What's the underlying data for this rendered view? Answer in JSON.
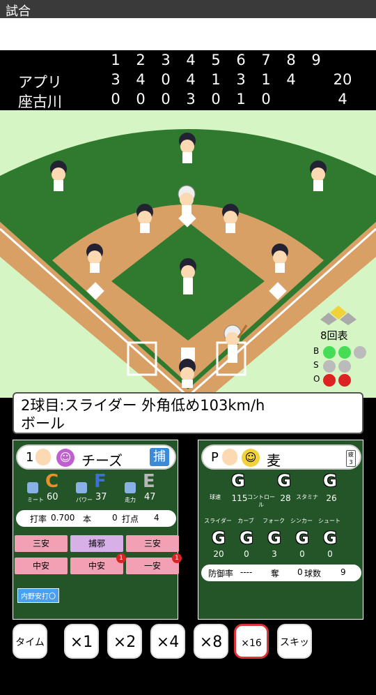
{
  "window_title": "試合",
  "scoreboard": {
    "innings": [
      "1",
      "2",
      "3",
      "4",
      "5",
      "6",
      "7",
      "8",
      "9"
    ],
    "teams": [
      {
        "name": "アプリ",
        "scores": [
          "3",
          "4",
          "0",
          "4",
          "1",
          "3",
          "1",
          "4",
          ""
        ],
        "total": "20"
      },
      {
        "name": "座古川",
        "scores": [
          "0",
          "0",
          "0",
          "3",
          "0",
          "1",
          "0",
          "",
          ""
        ],
        "total": "4"
      }
    ]
  },
  "inning_label": "8回表",
  "count": {
    "b_label": "B",
    "s_label": "S",
    "o_label": "O",
    "balls": 2,
    "strikes": 0,
    "outs": 2,
    "ball_color": "#44dd55",
    "strike_color": "#f2d23a",
    "out_color": "#dd2222",
    "off_color": "#bbbbbb"
  },
  "play": {
    "line1": "2球目:スライダー 外角低め103km/h",
    "line2": "ボール"
  },
  "batter": {
    "order": "1",
    "name": "チーズ",
    "position": "捕",
    "stats": [
      {
        "label": "ミート",
        "grade": "C",
        "value": "60",
        "color": "#e8902a"
      },
      {
        "label": "パワー",
        "grade": "F",
        "value": "37",
        "color": "#3f70d8"
      },
      {
        "label": "走力",
        "grade": "E",
        "value": "47",
        "color": "#b8b8b8"
      }
    ],
    "avg_label": "打率",
    "avg": "0.700",
    "hr_label": "本",
    "hr": "0",
    "rbi_label": "打点",
    "rbi": "4",
    "history": [
      {
        "text": "三安",
        "color": "#f4a0b4",
        "badge": ""
      },
      {
        "text": "捕邪",
        "color": "#d8b0e8",
        "badge": ""
      },
      {
        "text": "三安",
        "color": "#f4a0b4",
        "badge": ""
      },
      {
        "text": "中安",
        "color": "#f4a0b4",
        "badge": ""
      },
      {
        "text": "中安",
        "color": "#f4a0b4",
        "badge": "1"
      },
      {
        "text": "一安",
        "color": "#f4a0b4",
        "badge": "1"
      }
    ],
    "skill": "内野安打〇"
  },
  "pitcher": {
    "position": "P",
    "name": "麦",
    "tag": "疲3",
    "stats": [
      {
        "label": "球速",
        "grade": "G",
        "value": "115"
      },
      {
        "label": "コントロール",
        "grade": "G",
        "value": "28"
      },
      {
        "label": "スタミナ",
        "grade": "G",
        "value": "26"
      }
    ],
    "pitches": [
      {
        "label": "スライダー",
        "grade": "G",
        "value": "20"
      },
      {
        "label": "カーブ",
        "grade": "G",
        "value": "0"
      },
      {
        "label": "フォーク",
        "grade": "G",
        "value": "3"
      },
      {
        "label": "シンカー",
        "grade": "G",
        "value": "0"
      },
      {
        "label": "シュート",
        "grade": "G",
        "value": "0"
      }
    ],
    "era_label": "防御率",
    "era": "----",
    "k_label": "奪",
    "k": "0",
    "pitches_label": "球数",
    "pitch_count": "9"
  },
  "buttons": [
    {
      "label": "タイム"
    },
    {
      "label": "×1"
    },
    {
      "label": "×2"
    },
    {
      "label": "×4"
    },
    {
      "label": "×8"
    },
    {
      "label": "×16",
      "active": true
    },
    {
      "label": "スキップ"
    }
  ]
}
